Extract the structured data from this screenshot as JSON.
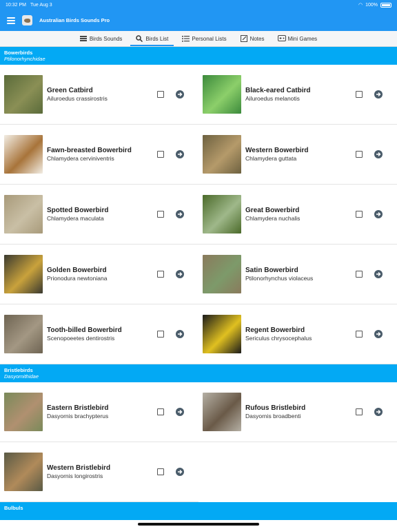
{
  "status": {
    "time": "10:32 PM",
    "day": "Tue Aug 3",
    "battery": "100%"
  },
  "app": {
    "title": "Australian Birds Sounds Pro"
  },
  "tabs": [
    {
      "label": "Birds Sounds",
      "icon": "list-icon"
    },
    {
      "label": "Birds List",
      "icon": "search-icon",
      "active": true
    },
    {
      "label": "Personal Lists",
      "icon": "checklist-icon"
    },
    {
      "label": "Notes",
      "icon": "notes-icon"
    },
    {
      "label": "Mini Games",
      "icon": "gamepad-icon"
    }
  ],
  "sections": [
    {
      "title": "Bowerbirds",
      "family": "Ptilonorhynchidae",
      "birds": [
        {
          "common": "Green Catbird",
          "sci": "Ailuroedus crassirostris",
          "colors": [
            "#5a6b3a",
            "#8a8f55"
          ]
        },
        {
          "common": "Black-eared Catbird",
          "sci": "Ailuroedus melanotis",
          "colors": [
            "#3c8a3c",
            "#8ccf6a"
          ]
        },
        {
          "common": "Fawn-breasted Bowerbird",
          "sci": "Chlamydera cerviniventris",
          "colors": [
            "#f2ede4",
            "#a8743a"
          ]
        },
        {
          "common": "Western Bowerbird",
          "sci": "Chlamydera guttata",
          "colors": [
            "#6d6140",
            "#b59a6a"
          ]
        },
        {
          "common": "Spotted Bowerbird",
          "sci": "Chlamydera maculata",
          "colors": [
            "#a89a7a",
            "#c9bfa5"
          ]
        },
        {
          "common": "Great Bowerbird",
          "sci": "Chlamydera nuchalis",
          "colors": [
            "#4b6a2a",
            "#9fb88a"
          ]
        },
        {
          "common": "Golden Bowerbird",
          "sci": "Prionodura newtoniana",
          "colors": [
            "#3a3a30",
            "#c9a23c"
          ]
        },
        {
          "common": "Satin Bowerbird",
          "sci": "Ptilonorhynchus violaceus",
          "colors": [
            "#8a7a5c",
            "#7d9a6a"
          ]
        },
        {
          "common": "Tooth-billed Bowerbird",
          "sci": "Scenopoeetes dentirostris",
          "colors": [
            "#6e6452",
            "#a39783"
          ]
        },
        {
          "common": "Regent Bowerbird",
          "sci": "Sericulus chrysocephalus",
          "colors": [
            "#1a1a1a",
            "#e0c020"
          ]
        }
      ]
    },
    {
      "title": "Bristlebirds",
      "family": "Dasyornithidae",
      "birds": [
        {
          "common": "Eastern Bristlebird",
          "sci": "Dasyornis brachypterus",
          "colors": [
            "#7a8a5a",
            "#b09070"
          ]
        },
        {
          "common": "Rufous Bristlebird",
          "sci": "Dasyornis broadbenti",
          "colors": [
            "#b5b0a5",
            "#6a5a48"
          ]
        },
        {
          "common": "Western Bristlebird",
          "sci": "Dasyornis longirostris",
          "colors": [
            "#5a5a45",
            "#b08a5a"
          ]
        }
      ]
    },
    {
      "title": "Bulbuls",
      "family": "",
      "birds": []
    }
  ],
  "icons": {
    "checkbox": "checkbox-icon",
    "go": "arrow-right-circle-icon"
  }
}
